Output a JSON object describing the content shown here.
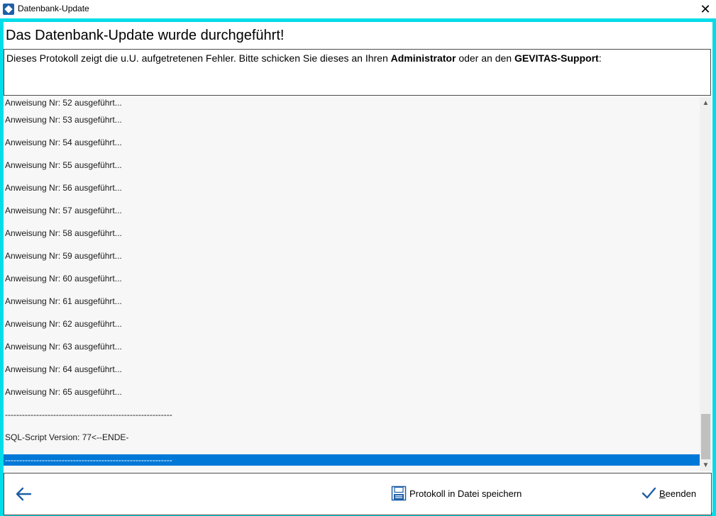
{
  "window": {
    "title": "Datenbank-Update",
    "close_glyph": "✕"
  },
  "heading": "Das Datenbank-Update wurde durchgeführt!",
  "info": {
    "text_1": "Dieses Protokoll zeigt die u.U. aufgetretenen Fehler. Bitte schicken Sie dieses an Ihren ",
    "bold_1": "Administrator",
    "text_2": " oder an den ",
    "bold_2": "GEVITAS-Support",
    "text_3": ":"
  },
  "log": {
    "lines": [
      "Anweisung Nr: 52 ausgeführt...",
      "Anweisung Nr: 53 ausgeführt...",
      "Anweisung Nr: 54 ausgeführt...",
      "Anweisung Nr: 55 ausgeführt...",
      "Anweisung Nr: 56 ausgeführt...",
      "Anweisung Nr: 57 ausgeführt...",
      "Anweisung Nr: 58 ausgeführt...",
      "Anweisung Nr: 59 ausgeführt...",
      "Anweisung Nr: 60 ausgeführt...",
      "Anweisung Nr: 61 ausgeführt...",
      "Anweisung Nr: 62 ausgeführt...",
      "Anweisung Nr: 63 ausgeführt...",
      "Anweisung Nr: 64 ausgeführt...",
      "Anweisung Nr: 65 ausgeführt...",
      "-----------------------------------------------------------",
      "SQL-Script Version: 77<--ENDE-"
    ],
    "selected_line": "-----------------------------------------------------------"
  },
  "footer": {
    "back_icon": "arrow-left-icon",
    "save_icon": "floppy-disk-icon",
    "save_label": "Protokoll in Datei speichern",
    "end_icon": "checkmark-icon",
    "end_label_first": "B",
    "end_label_rest": "eenden"
  },
  "colors": {
    "frame": "#00dce8",
    "selection": "#0078d7",
    "icon_blue": "#1f5fa8"
  }
}
